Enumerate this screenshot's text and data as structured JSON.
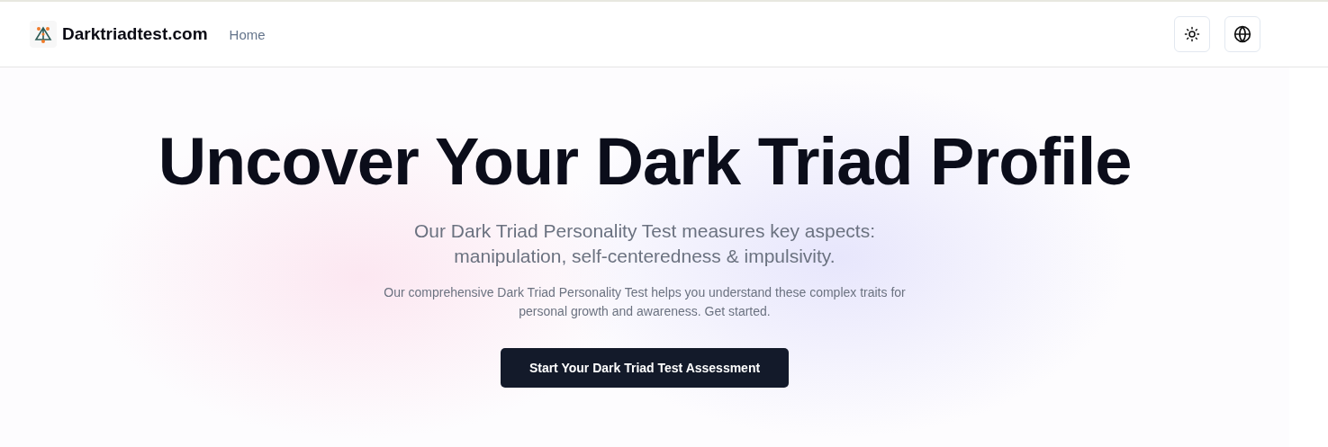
{
  "header": {
    "brand": "Darktriadtest.com",
    "nav": [
      {
        "label": "Home"
      }
    ]
  },
  "hero": {
    "title": "Uncover Your Dark Triad Profile",
    "subtitle_lines": [
      "Our Dark Triad Personality Test measures key aspects:",
      "manipulation, self-centeredness & impulsivity."
    ],
    "description_lines": [
      "Our comprehensive Dark Triad Personality Test helps you understand these complex traits for",
      "personal growth and awareness. Get started."
    ],
    "cta": "Start Your Dark Triad Test Assessment"
  }
}
